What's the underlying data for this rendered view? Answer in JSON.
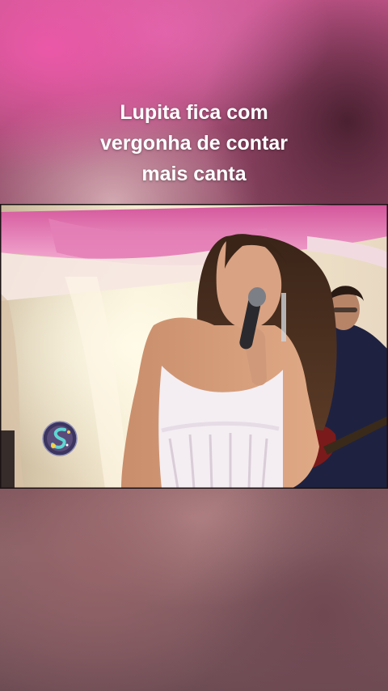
{
  "caption": {
    "lines": [
      "Lupita fica com",
      "vergonha de contar",
      "mais canta"
    ]
  },
  "video": {
    "description_icon": "video-frame"
  },
  "colors": {
    "drape_pink": "#e06aa8",
    "wall_cream": "#f3e6c8",
    "dress_white": "#f4eef2"
  }
}
